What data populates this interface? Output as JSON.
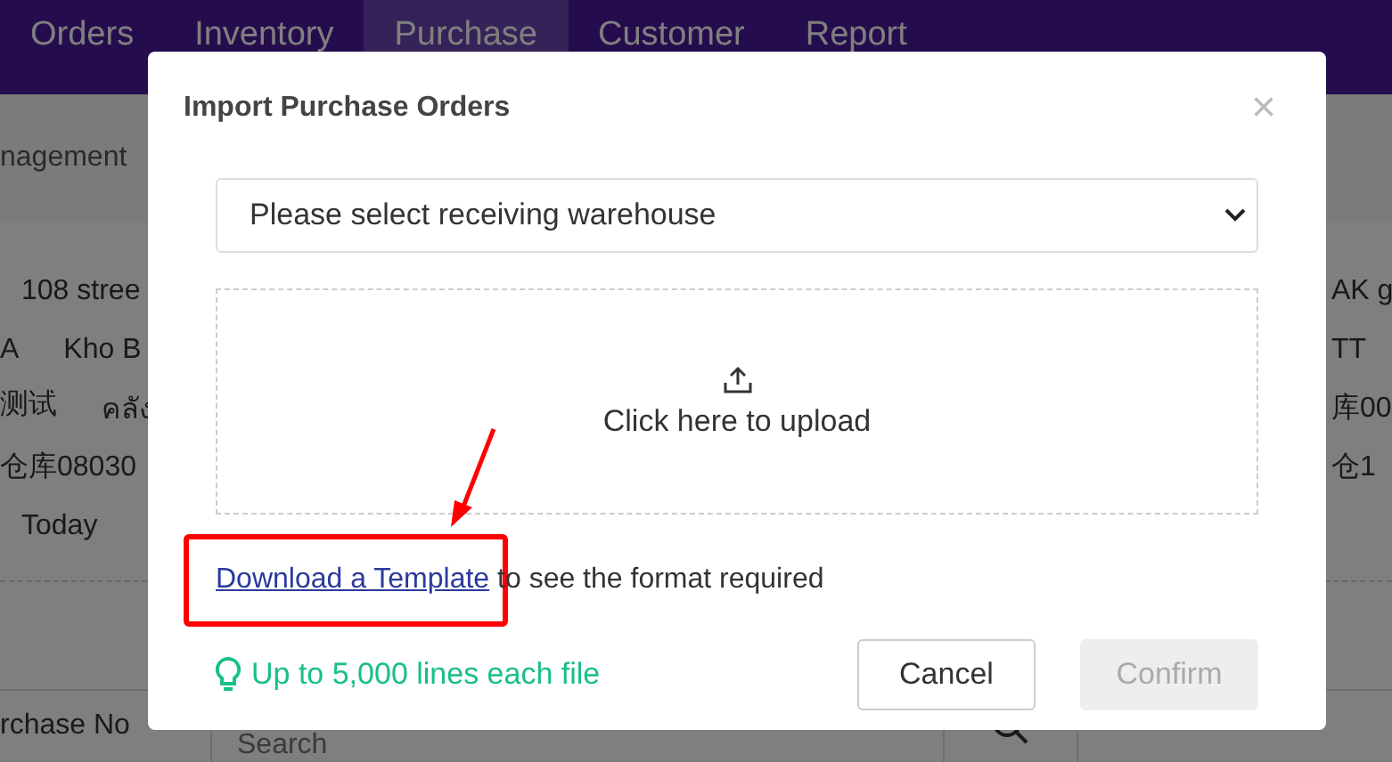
{
  "nav": {
    "items": [
      {
        "label": "Orders",
        "selected": false
      },
      {
        "label": "Inventory",
        "selected": false
      },
      {
        "label": "Purchase",
        "selected": true
      },
      {
        "label": "Customer",
        "selected": false
      },
      {
        "label": "Report",
        "selected": false
      }
    ]
  },
  "breadcrumb": "nagement",
  "rows": [
    {
      "left": [
        "108 stree"
      ],
      "right": "AK g"
    },
    {
      "left": [
        "A",
        "Kho B"
      ],
      "right": "TT"
    },
    {
      "left": [
        "测试",
        "คลัง"
      ],
      "right": "库00"
    },
    {
      "left": [
        "仓库08030"
      ],
      "right": "仓1"
    },
    {
      "left": [
        "Today"
      ],
      "right": ""
    }
  ],
  "search_bar": {
    "column": "rchase No",
    "placeholder": "Search"
  },
  "dialog": {
    "title": "Import Purchase Orders",
    "close": "×",
    "warehouse_select": {
      "value": "Please select receiving warehouse"
    },
    "upload": {
      "label": "Click here to upload"
    },
    "template": {
      "link": "Download a Template",
      "text": " to see the format required"
    },
    "tip": "Up to 5,000 lines each file",
    "buttons": [
      {
        "label": "Cancel",
        "kind": "secondary",
        "disabled": false
      },
      {
        "label": "Confirm",
        "kind": "primary",
        "disabled": true
      }
    ]
  }
}
